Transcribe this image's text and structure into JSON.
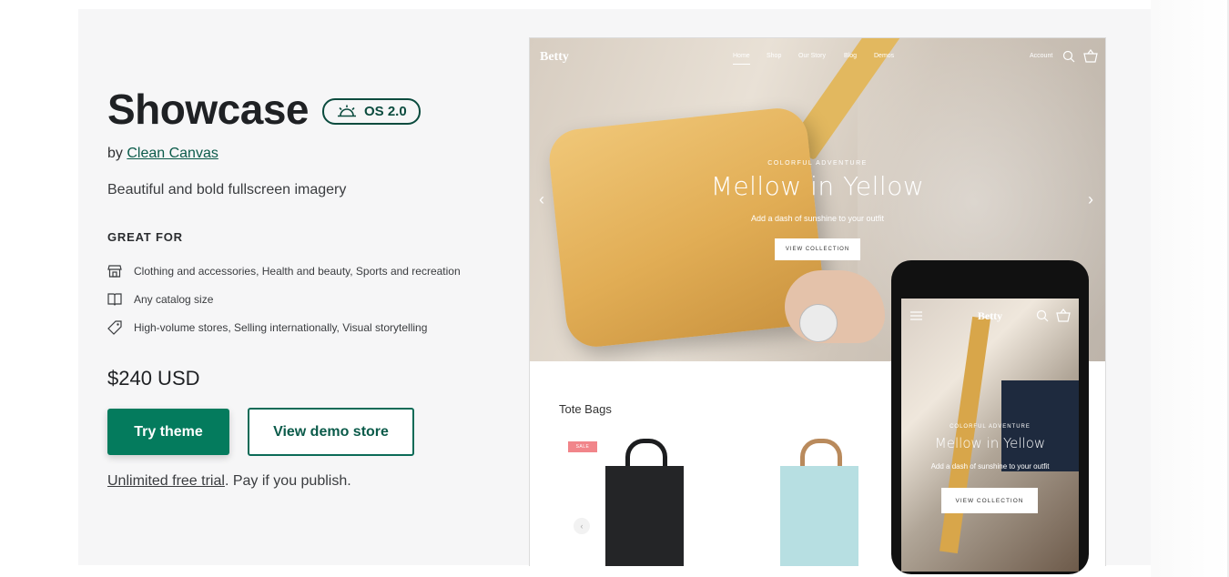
{
  "theme": {
    "name": "Showcase",
    "badge": "OS 2.0",
    "by_prefix": "by ",
    "author": "Clean Canvas",
    "tagline": "Beautiful and bold fullscreen imagery",
    "great_for_heading": "GREAT FOR",
    "features": [
      {
        "icon": "store-icon",
        "text": "Clothing and accessories, Health and beauty, Sports and recreation"
      },
      {
        "icon": "catalog-icon",
        "text": "Any catalog size"
      },
      {
        "icon": "tag-icon",
        "text": "High-volume stores, Selling internationally, Visual storytelling"
      }
    ],
    "price": "$240 USD",
    "try_button": "Try theme",
    "demo_button": "View demo store",
    "trial_link": "Unlimited free trial",
    "trial_rest": ". Pay if you publish."
  },
  "preview": {
    "desktop": {
      "logo": "Betty",
      "nav": [
        "Home",
        "Shop",
        "Our Story",
        "Blog",
        "Demos"
      ],
      "account": "Account",
      "eyebrow": "COLORFUL ADVENTURE",
      "title": "Mellow in Yellow",
      "subtitle": "Add a dash of sunshine to your outfit",
      "button": "VIEW COLLECTION",
      "collection_title": "Tote Bags",
      "sale_badge": "SALE",
      "arrow_left": "‹",
      "arrow_right": "›",
      "small_arrow": "‹"
    },
    "mobile": {
      "logo": "Betty",
      "eyebrow": "COLORFUL ADVENTURE",
      "title": "Mellow in Yellow",
      "subtitle": "Add a dash of sunshine to your outfit",
      "button": "VIEW COLLECTION"
    }
  },
  "colors": {
    "primary": "#047b5d",
    "badge": "#0b4b3e",
    "sale": "#f1858a"
  }
}
